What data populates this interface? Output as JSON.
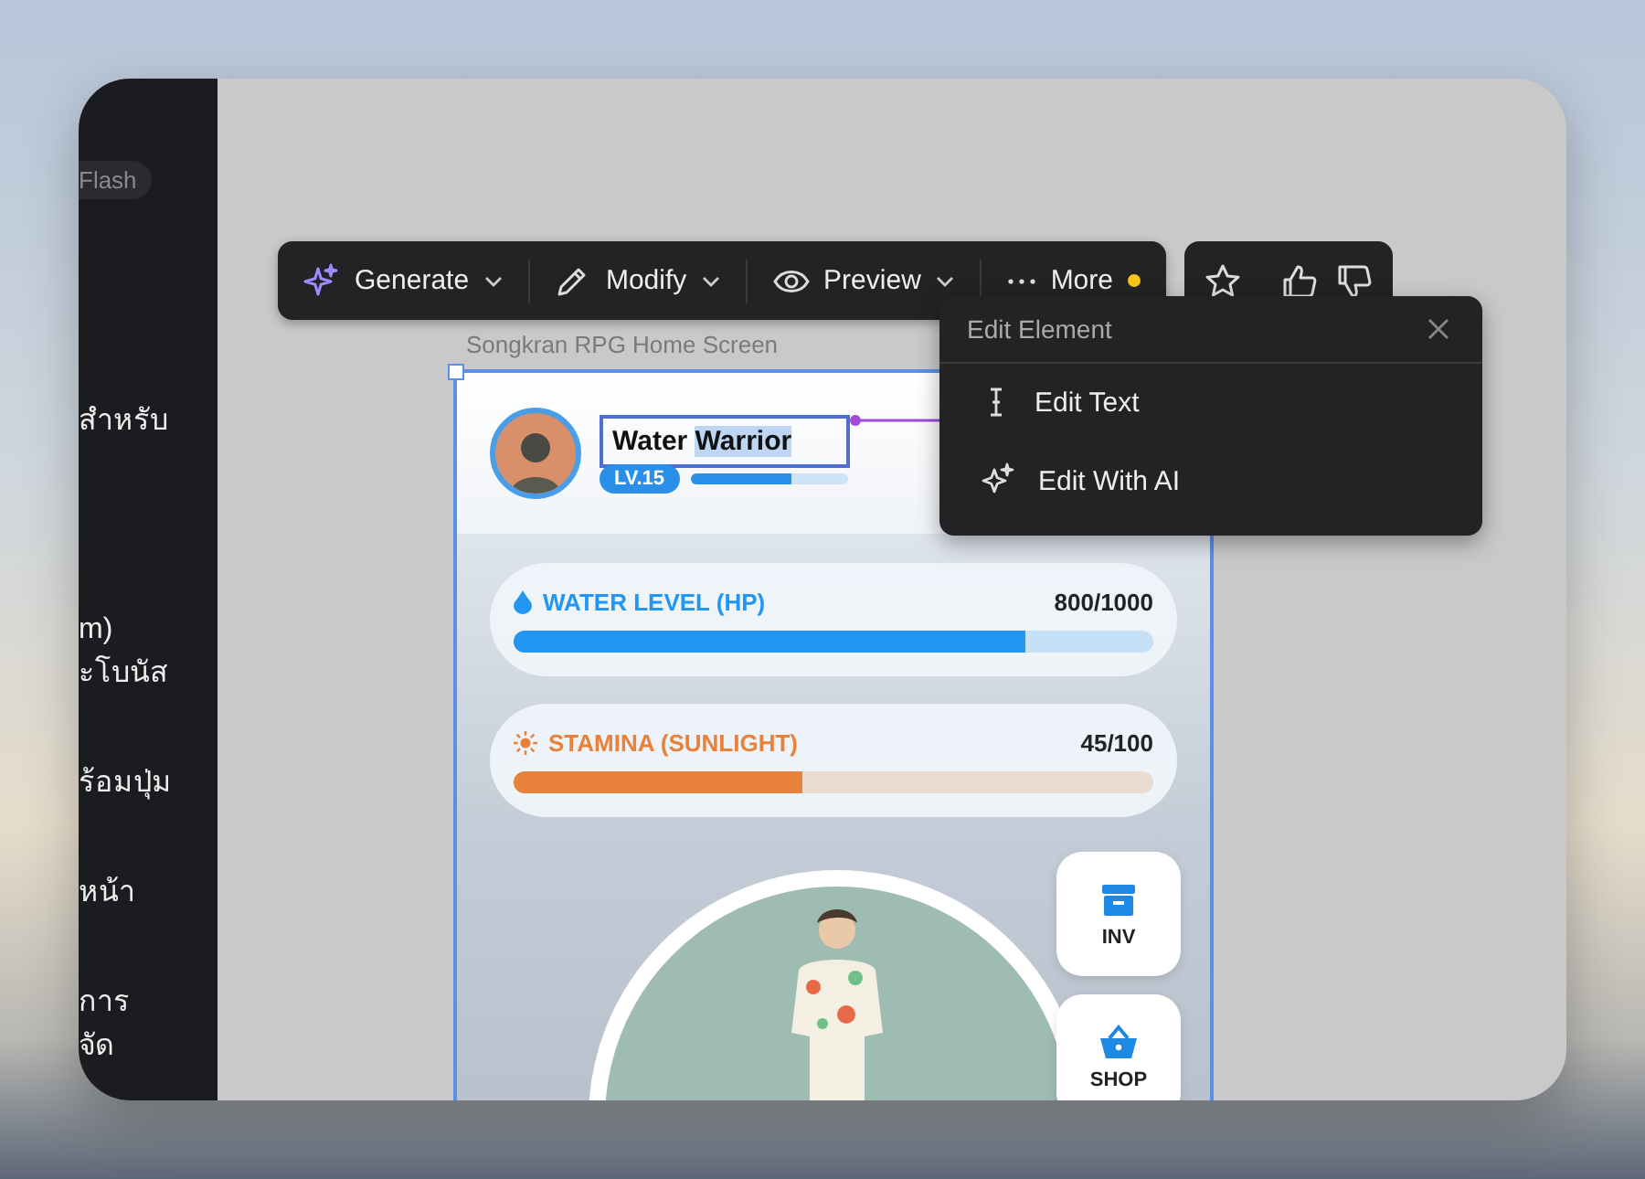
{
  "sidebar": {
    "chip": "Flash",
    "lines": [
      "สำหรับ",
      "m)",
      "ะโบนัส",
      "ร้อมปุ่ม",
      "หน้า",
      "การ",
      "จัด"
    ]
  },
  "toolbar": {
    "items": [
      {
        "kind": "generate",
        "label": "Generate"
      },
      {
        "kind": "modify",
        "label": "Modify"
      },
      {
        "kind": "preview",
        "label": "Preview"
      },
      {
        "kind": "more",
        "label": "More",
        "notification": true
      }
    ]
  },
  "feedback": [
    {
      "kind": "star"
    },
    {
      "kind": "like"
    },
    {
      "kind": "dislike"
    }
  ],
  "frame": {
    "title": "Songkran RPG Home Screen",
    "player": {
      "name_parts": [
        {
          "text": "Water",
          "selected": false
        },
        {
          "text": "Warrior",
          "selected": true
        }
      ],
      "level_badge": "LV.15",
      "level": 0.65
    },
    "stats": [
      {
        "kind": "water",
        "label": "WATER LEVEL (HP)",
        "value": "800/1000",
        "level": 0.8,
        "color": "#2196f3"
      },
      {
        "kind": "sun",
        "label": "STAMINA (SUNLIGHT)",
        "value": "45/100",
        "level": 0.45,
        "color": "#e8813a"
      }
    ],
    "side_buttons": [
      {
        "kind": "inventory",
        "label": "INV"
      },
      {
        "kind": "shop",
        "label": "SHOP"
      }
    ]
  },
  "popup": {
    "title": "Edit Element",
    "items": [
      {
        "kind": "text",
        "label": "Edit Text"
      },
      {
        "kind": "ai",
        "label": "Edit With AI"
      }
    ]
  }
}
